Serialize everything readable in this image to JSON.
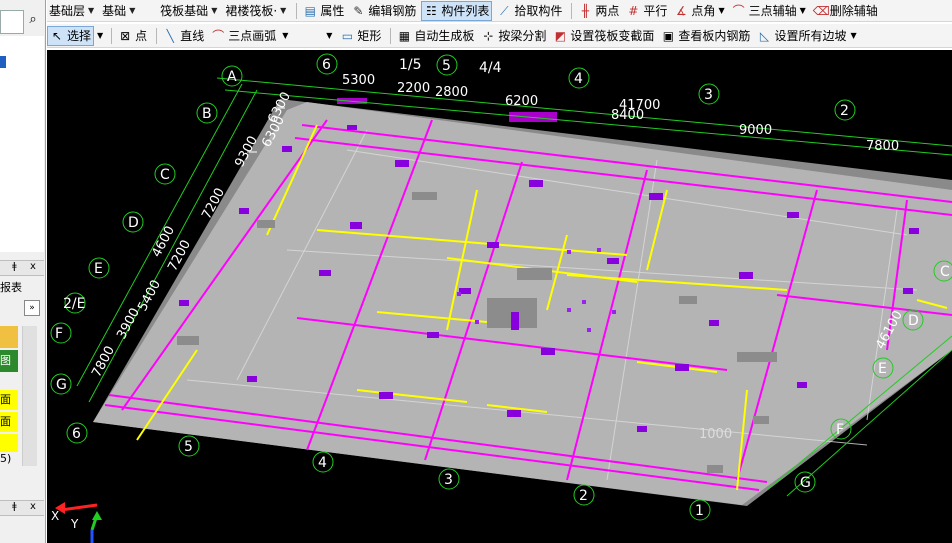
{
  "toolbar1": {
    "dropdowns": [
      "基础层",
      "基础",
      "筏板基础",
      "裙楼筏板·"
    ],
    "buttons": [
      "属性",
      "编辑钢筋",
      "构件列表",
      "拾取构件",
      "两点",
      "平行",
      "点角",
      "三点辅轴",
      "删除辅轴"
    ]
  },
  "toolbar2": {
    "buttons": [
      "选择",
      "点",
      "直线",
      "三点画弧",
      "矩形",
      "自动生成板",
      "按梁分割",
      "设置筏板变截面",
      "查看板内钢筋",
      "设置所有边坡"
    ]
  },
  "leftpanel": {
    "search_icon": "search-icon",
    "panel_controls": [
      "ǂ",
      "x"
    ],
    "row_labels": [
      "报表",
      "图",
      "面",
      "面",
      "5)"
    ],
    "scroll_btn": "»"
  },
  "viewport": {
    "axis_labels_left": [
      "A",
      "B",
      "C",
      "D",
      "E",
      "2/E",
      "F",
      "G",
      "6"
    ],
    "axis_labels_top": [
      "6",
      "1/5",
      "5",
      "4/4",
      "4",
      "3",
      "2"
    ],
    "axis_labels_right": [
      "C",
      "D",
      "E",
      "F",
      "G"
    ],
    "axis_labels_bottom": [
      "5",
      "4",
      "3",
      "2",
      "1"
    ],
    "dims_top": [
      "5300",
      "2200",
      "2800",
      "6200",
      "41700",
      "8400",
      "9000",
      "7800"
    ],
    "dims_left": [
      "6300",
      "6300",
      "9300",
      "7200",
      "7200",
      "4600",
      "5400",
      "3900",
      "7800"
    ],
    "dims_right": [
      "46100"
    ],
    "floor_label": "1000",
    "ucs_y": "Y",
    "ucs_x": "X"
  },
  "colors": {
    "grid": "#22cc22",
    "slab": "#b0b0b0",
    "beam_magenta": "#ff00ff",
    "beam_yellow": "#ffff00",
    "column": "#8800dd"
  }
}
